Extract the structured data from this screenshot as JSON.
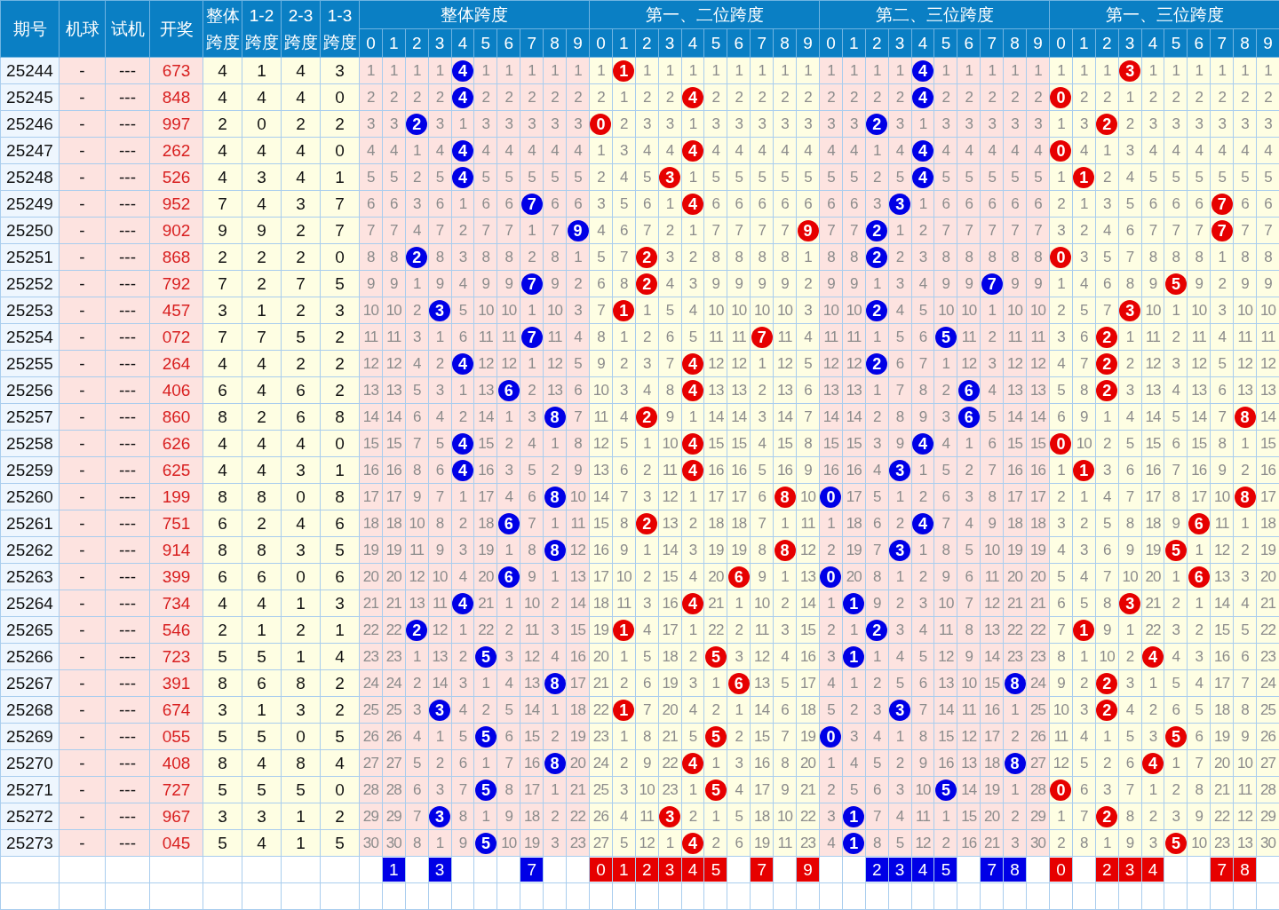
{
  "header": {
    "fixed": [
      "期号",
      "机球",
      "试机",
      "开奖"
    ],
    "spans": [
      "整体跨度",
      "1-2跨度",
      "2-3跨度",
      "1-3跨度"
    ]
  },
  "groups": [
    {
      "title": "整体跨度",
      "color": "#0000e6",
      "digits": [
        "0",
        "1",
        "2",
        "3",
        "4",
        "5",
        "6",
        "7",
        "8",
        "9"
      ]
    },
    {
      "title": "第一、二位跨度",
      "color": "#e60000",
      "digits": [
        "0",
        "1",
        "2",
        "3",
        "4",
        "5",
        "6",
        "7",
        "8",
        "9"
      ]
    },
    {
      "title": "第二、三位跨度",
      "color": "#0000e6",
      "digits": [
        "0",
        "1",
        "2",
        "3",
        "4",
        "5",
        "6",
        "7",
        "8",
        "9"
      ]
    },
    {
      "title": "第一、三位跨度",
      "color": "#e60000",
      "digits": [
        "0",
        "1",
        "2",
        "3",
        "4",
        "5",
        "6",
        "7",
        "8",
        "9"
      ]
    }
  ],
  "rows": [
    {
      "issue": "25244",
      "machine": "-",
      "test": "---",
      "draw": "673",
      "spans": [
        "4",
        "1",
        "4",
        "3"
      ],
      "groups": [
        [
          "1",
          "1",
          "1",
          "1",
          {
            "text": "4",
            "hit": true
          },
          "1",
          "1",
          "1",
          "1",
          "1"
        ],
        [
          "1",
          {
            "text": "1",
            "hit": true
          },
          "1",
          "1",
          "1",
          "1",
          "1",
          "1",
          "1",
          "1"
        ],
        [
          "1",
          "1",
          "1",
          "1",
          {
            "text": "4",
            "hit": true
          },
          "1",
          "1",
          "1",
          "1",
          "1"
        ],
        [
          "1",
          "1",
          "1",
          {
            "text": "3",
            "hit": true
          },
          "1",
          "1",
          "1",
          "1",
          "1",
          "1"
        ]
      ]
    },
    {
      "issue": "25245",
      "machine": "-",
      "test": "---",
      "draw": "848",
      "spans": [
        "4",
        "4",
        "4",
        "0"
      ],
      "groups": [
        [
          "2",
          "2",
          "2",
          "2",
          {
            "text": "4",
            "hit": true
          },
          "2",
          "2",
          "2",
          "2",
          "2"
        ],
        [
          "2",
          "1",
          "2",
          "2",
          {
            "text": "4",
            "hit": true
          },
          "2",
          "2",
          "2",
          "2",
          "2"
        ],
        [
          "2",
          "2",
          "2",
          "2",
          {
            "text": "4",
            "hit": true
          },
          "2",
          "2",
          "2",
          "2",
          "2"
        ],
        [
          {
            "text": "0",
            "hit": true
          },
          "2",
          "2",
          "1",
          "2",
          "2",
          "2",
          "2",
          "2",
          "2"
        ]
      ]
    },
    {
      "issue": "25246",
      "machine": "-",
      "test": "---",
      "draw": "997",
      "spans": [
        "2",
        "0",
        "2",
        "2"
      ],
      "groups": [
        [
          "3",
          "3",
          {
            "text": "2",
            "hit": true
          },
          "3",
          "1",
          "3",
          "3",
          "3",
          "3",
          "3"
        ],
        [
          {
            "text": "0",
            "hit": true
          },
          "2",
          "3",
          "3",
          "1",
          "3",
          "3",
          "3",
          "3",
          "3"
        ],
        [
          "3",
          "3",
          {
            "text": "2",
            "hit": true
          },
          "3",
          "1",
          "3",
          "3",
          "3",
          "3",
          "3"
        ],
        [
          "1",
          "3",
          {
            "text": "2",
            "hit": true
          },
          "2",
          "3",
          "3",
          "3",
          "3",
          "3",
          "3"
        ]
      ]
    },
    {
      "issue": "25247",
      "machine": "-",
      "test": "---",
      "draw": "262",
      "spans": [
        "4",
        "4",
        "4",
        "0"
      ],
      "groups": [
        [
          "4",
          "4",
          "1",
          "4",
          {
            "text": "4",
            "hit": true
          },
          "4",
          "4",
          "4",
          "4",
          "4"
        ],
        [
          "1",
          "3",
          "4",
          "4",
          {
            "text": "4",
            "hit": true
          },
          "4",
          "4",
          "4",
          "4",
          "4"
        ],
        [
          "4",
          "4",
          "1",
          "4",
          {
            "text": "4",
            "hit": true
          },
          "4",
          "4",
          "4",
          "4",
          "4"
        ],
        [
          {
            "text": "0",
            "hit": true
          },
          "4",
          "1",
          "3",
          "4",
          "4",
          "4",
          "4",
          "4",
          "4"
        ]
      ]
    },
    {
      "issue": "25248",
      "machine": "-",
      "test": "---",
      "draw": "526",
      "spans": [
        "4",
        "3",
        "4",
        "1"
      ],
      "groups": [
        [
          "5",
          "5",
          "2",
          "5",
          {
            "text": "4",
            "hit": true
          },
          "5",
          "5",
          "5",
          "5",
          "5"
        ],
        [
          "2",
          "4",
          "5",
          {
            "text": "3",
            "hit": true
          },
          "1",
          "5",
          "5",
          "5",
          "5",
          "5"
        ],
        [
          "5",
          "5",
          "2",
          "5",
          {
            "text": "4",
            "hit": true
          },
          "5",
          "5",
          "5",
          "5",
          "5"
        ],
        [
          "1",
          {
            "text": "1",
            "hit": true
          },
          "2",
          "4",
          "5",
          "5",
          "5",
          "5",
          "5",
          "5"
        ]
      ]
    },
    {
      "issue": "25249",
      "machine": "-",
      "test": "---",
      "draw": "952",
      "spans": [
        "7",
        "4",
        "3",
        "7"
      ],
      "groups": [
        [
          "6",
          "6",
          "3",
          "6",
          "1",
          "6",
          "6",
          {
            "text": "7",
            "hit": true
          },
          "6",
          "6"
        ],
        [
          "3",
          "5",
          "6",
          "1",
          {
            "text": "4",
            "hit": true
          },
          "6",
          "6",
          "6",
          "6",
          "6"
        ],
        [
          "6",
          "6",
          "3",
          {
            "text": "3",
            "hit": true
          },
          "1",
          "6",
          "6",
          "6",
          "6",
          "6"
        ],
        [
          "2",
          "1",
          "3",
          "5",
          "6",
          "6",
          "6",
          {
            "text": "7",
            "hit": true
          },
          "6",
          "6"
        ]
      ]
    },
    {
      "issue": "25250",
      "machine": "-",
      "test": "---",
      "draw": "902",
      "spans": [
        "9",
        "9",
        "2",
        "7"
      ],
      "groups": [
        [
          "7",
          "7",
          "4",
          "7",
          "2",
          "7",
          "7",
          "1",
          "7",
          {
            "text": "9",
            "hit": true
          }
        ],
        [
          "4",
          "6",
          "7",
          "2",
          "1",
          "7",
          "7",
          "7",
          "7",
          {
            "text": "9",
            "hit": true
          }
        ],
        [
          "7",
          "7",
          {
            "text": "2",
            "hit": true
          },
          "1",
          "2",
          "7",
          "7",
          "7",
          "7",
          "7"
        ],
        [
          "3",
          "2",
          "4",
          "6",
          "7",
          "7",
          "7",
          {
            "text": "7",
            "hit": true
          },
          "7",
          "7"
        ]
      ]
    },
    {
      "issue": "25251",
      "machine": "-",
      "test": "---",
      "draw": "868",
      "spans": [
        "2",
        "2",
        "2",
        "0"
      ],
      "groups": [
        [
          "8",
          "8",
          {
            "text": "2",
            "hit": true
          },
          "8",
          "3",
          "8",
          "8",
          "2",
          "8",
          "1"
        ],
        [
          "5",
          "7",
          {
            "text": "2",
            "hit": true
          },
          "3",
          "2",
          "8",
          "8",
          "8",
          "8",
          "1"
        ],
        [
          "8",
          "8",
          {
            "text": "2",
            "hit": true
          },
          "2",
          "3",
          "8",
          "8",
          "8",
          "8",
          "8"
        ],
        [
          {
            "text": "0",
            "hit": true
          },
          "3",
          "5",
          "7",
          "8",
          "8",
          "8",
          "1",
          "8",
          "8"
        ]
      ]
    },
    {
      "issue": "25252",
      "machine": "-",
      "test": "---",
      "draw": "792",
      "spans": [
        "7",
        "2",
        "7",
        "5"
      ],
      "groups": [
        [
          "9",
          "9",
          "1",
          "9",
          "4",
          "9",
          "9",
          {
            "text": "7",
            "hit": true
          },
          "9",
          "2"
        ],
        [
          "6",
          "8",
          {
            "text": "2",
            "hit": true
          },
          "4",
          "3",
          "9",
          "9",
          "9",
          "9",
          "2"
        ],
        [
          "9",
          "9",
          "1",
          "3",
          "4",
          "9",
          "9",
          {
            "text": "7",
            "hit": true
          },
          "9",
          "9"
        ],
        [
          "1",
          "4",
          "6",
          "8",
          "9",
          {
            "text": "5",
            "hit": true
          },
          "9",
          "2",
          "9",
          "9"
        ]
      ]
    },
    {
      "issue": "25253",
      "machine": "-",
      "test": "---",
      "draw": "457",
      "spans": [
        "3",
        "1",
        "2",
        "3"
      ],
      "groups": [
        [
          "10",
          "10",
          "2",
          {
            "text": "3",
            "hit": true
          },
          "5",
          "10",
          "10",
          "1",
          "10",
          "3"
        ],
        [
          "7",
          {
            "text": "1",
            "hit": true
          },
          "1",
          "5",
          "4",
          "10",
          "10",
          "10",
          "10",
          "3"
        ],
        [
          "10",
          "10",
          {
            "text": "2",
            "hit": true
          },
          "4",
          "5",
          "10",
          "10",
          "1",
          "10",
          "10"
        ],
        [
          "2",
          "5",
          "7",
          {
            "text": "3",
            "hit": true
          },
          "10",
          "1",
          "10",
          "3",
          "10",
          "10"
        ]
      ]
    },
    {
      "issue": "25254",
      "machine": "-",
      "test": "---",
      "draw": "072",
      "spans": [
        "7",
        "7",
        "5",
        "2"
      ],
      "groups": [
        [
          "11",
          "11",
          "3",
          "1",
          "6",
          "11",
          "11",
          {
            "text": "7",
            "hit": true
          },
          "11",
          "4"
        ],
        [
          "8",
          "1",
          "2",
          "6",
          "5",
          "11",
          "11",
          {
            "text": "7",
            "hit": true
          },
          "11",
          "4"
        ],
        [
          "11",
          "11",
          "1",
          "5",
          "6",
          {
            "text": "5",
            "hit": true
          },
          "11",
          "2",
          "11",
          "11"
        ],
        [
          "3",
          "6",
          {
            "text": "2",
            "hit": true
          },
          "1",
          "11",
          "2",
          "11",
          "4",
          "11",
          "11"
        ]
      ]
    },
    {
      "issue": "25255",
      "machine": "-",
      "test": "---",
      "draw": "264",
      "spans": [
        "4",
        "4",
        "2",
        "2"
      ],
      "groups": [
        [
          "12",
          "12",
          "4",
          "2",
          {
            "text": "4",
            "hit": true
          },
          "12",
          "12",
          "1",
          "12",
          "5"
        ],
        [
          "9",
          "2",
          "3",
          "7",
          {
            "text": "4",
            "hit": true
          },
          "12",
          "12",
          "1",
          "12",
          "5"
        ],
        [
          "12",
          "12",
          {
            "text": "2",
            "hit": true
          },
          "6",
          "7",
          "1",
          "12",
          "3",
          "12",
          "12"
        ],
        [
          "4",
          "7",
          {
            "text": "2",
            "hit": true
          },
          "2",
          "12",
          "3",
          "12",
          "5",
          "12",
          "12"
        ]
      ]
    },
    {
      "issue": "25256",
      "machine": "-",
      "test": "---",
      "draw": "406",
      "spans": [
        "6",
        "4",
        "6",
        "2"
      ],
      "groups": [
        [
          "13",
          "13",
          "5",
          "3",
          "1",
          "13",
          {
            "text": "6",
            "hit": true
          },
          "2",
          "13",
          "6"
        ],
        [
          "10",
          "3",
          "4",
          "8",
          {
            "text": "4",
            "hit": true
          },
          "13",
          "13",
          "2",
          "13",
          "6"
        ],
        [
          "13",
          "13",
          "1",
          "7",
          "8",
          "2",
          {
            "text": "6",
            "hit": true
          },
          "4",
          "13",
          "13"
        ],
        [
          "5",
          "8",
          {
            "text": "2",
            "hit": true
          },
          "3",
          "13",
          "4",
          "13",
          "6",
          "13",
          "13"
        ]
      ]
    },
    {
      "issue": "25257",
      "machine": "-",
      "test": "---",
      "draw": "860",
      "spans": [
        "8",
        "2",
        "6",
        "8"
      ],
      "groups": [
        [
          "14",
          "14",
          "6",
          "4",
          "2",
          "14",
          "1",
          "3",
          {
            "text": "8",
            "hit": true
          },
          "7"
        ],
        [
          "11",
          "4",
          {
            "text": "2",
            "hit": true
          },
          "9",
          "1",
          "14",
          "14",
          "3",
          "14",
          "7"
        ],
        [
          "14",
          "14",
          "2",
          "8",
          "9",
          "3",
          {
            "text": "6",
            "hit": true
          },
          "5",
          "14",
          "14"
        ],
        [
          "6",
          "9",
          "1",
          "4",
          "14",
          "5",
          "14",
          "7",
          {
            "text": "8",
            "hit": true
          },
          "14"
        ]
      ]
    },
    {
      "issue": "25258",
      "machine": "-",
      "test": "---",
      "draw": "626",
      "spans": [
        "4",
        "4",
        "4",
        "0"
      ],
      "groups": [
        [
          "15",
          "15",
          "7",
          "5",
          {
            "text": "4",
            "hit": true
          },
          "15",
          "2",
          "4",
          "1",
          "8"
        ],
        [
          "12",
          "5",
          "1",
          "10",
          {
            "text": "4",
            "hit": true
          },
          "15",
          "15",
          "4",
          "15",
          "8"
        ],
        [
          "15",
          "15",
          "3",
          "9",
          {
            "text": "4",
            "hit": true
          },
          "4",
          "1",
          "6",
          "15",
          "15"
        ],
        [
          {
            "text": "0",
            "hit": true
          },
          "10",
          "2",
          "5",
          "15",
          "6",
          "15",
          "8",
          "1",
          "15"
        ]
      ]
    },
    {
      "issue": "25259",
      "machine": "-",
      "test": "---",
      "draw": "625",
      "spans": [
        "4",
        "4",
        "3",
        "1"
      ],
      "groups": [
        [
          "16",
          "16",
          "8",
          "6",
          {
            "text": "4",
            "hit": true
          },
          "16",
          "3",
          "5",
          "2",
          "9"
        ],
        [
          "13",
          "6",
          "2",
          "11",
          {
            "text": "4",
            "hit": true
          },
          "16",
          "16",
          "5",
          "16",
          "9"
        ],
        [
          "16",
          "16",
          "4",
          {
            "text": "3",
            "hit": true
          },
          "1",
          "5",
          "2",
          "7",
          "16",
          "16"
        ],
        [
          "1",
          {
            "text": "1",
            "hit": true
          },
          "3",
          "6",
          "16",
          "7",
          "16",
          "9",
          "2",
          "16"
        ]
      ]
    },
    {
      "issue": "25260",
      "machine": "-",
      "test": "---",
      "draw": "199",
      "spans": [
        "8",
        "8",
        "0",
        "8"
      ],
      "groups": [
        [
          "17",
          "17",
          "9",
          "7",
          "1",
          "17",
          "4",
          "6",
          {
            "text": "8",
            "hit": true
          },
          "10"
        ],
        [
          "14",
          "7",
          "3",
          "12",
          "1",
          "17",
          "17",
          "6",
          {
            "text": "8",
            "hit": true
          },
          "10"
        ],
        [
          {
            "text": "0",
            "hit": true
          },
          "17",
          "5",
          "1",
          "2",
          "6",
          "3",
          "8",
          "17",
          "17"
        ],
        [
          "2",
          "1",
          "4",
          "7",
          "17",
          "8",
          "17",
          "10",
          {
            "text": "8",
            "hit": true
          },
          "17"
        ]
      ]
    },
    {
      "issue": "25261",
      "machine": "-",
      "test": "---",
      "draw": "751",
      "spans": [
        "6",
        "2",
        "4",
        "6"
      ],
      "groups": [
        [
          "18",
          "18",
          "10",
          "8",
          "2",
          "18",
          {
            "text": "6",
            "hit": true
          },
          "7",
          "1",
          "11"
        ],
        [
          "15",
          "8",
          {
            "text": "2",
            "hit": true
          },
          "13",
          "2",
          "18",
          "18",
          "7",
          "1",
          "11"
        ],
        [
          "1",
          "18",
          "6",
          "2",
          {
            "text": "4",
            "hit": true
          },
          "7",
          "4",
          "9",
          "18",
          "18"
        ],
        [
          "3",
          "2",
          "5",
          "8",
          "18",
          "9",
          {
            "text": "6",
            "hit": true
          },
          "11",
          "1",
          "18"
        ]
      ]
    },
    {
      "issue": "25262",
      "machine": "-",
      "test": "---",
      "draw": "914",
      "spans": [
        "8",
        "8",
        "3",
        "5"
      ],
      "groups": [
        [
          "19",
          "19",
          "11",
          "9",
          "3",
          "19",
          "1",
          "8",
          {
            "text": "8",
            "hit": true
          },
          "12"
        ],
        [
          "16",
          "9",
          "1",
          "14",
          "3",
          "19",
          "19",
          "8",
          {
            "text": "8",
            "hit": true
          },
          "12"
        ],
        [
          "2",
          "19",
          "7",
          {
            "text": "3",
            "hit": true
          },
          "1",
          "8",
          "5",
          "10",
          "19",
          "19"
        ],
        [
          "4",
          "3",
          "6",
          "9",
          "19",
          {
            "text": "5",
            "hit": true
          },
          "1",
          "12",
          "2",
          "19"
        ]
      ]
    },
    {
      "issue": "25263",
      "machine": "-",
      "test": "---",
      "draw": "399",
      "spans": [
        "6",
        "6",
        "0",
        "6"
      ],
      "groups": [
        [
          "20",
          "20",
          "12",
          "10",
          "4",
          "20",
          {
            "text": "6",
            "hit": true
          },
          "9",
          "1",
          "13"
        ],
        [
          "17",
          "10",
          "2",
          "15",
          "4",
          "20",
          {
            "text": "6",
            "hit": true
          },
          "9",
          "1",
          "13"
        ],
        [
          {
            "text": "0",
            "hit": true
          },
          "20",
          "8",
          "1",
          "2",
          "9",
          "6",
          "11",
          "20",
          "20"
        ],
        [
          "5",
          "4",
          "7",
          "10",
          "20",
          "1",
          {
            "text": "6",
            "hit": true
          },
          "13",
          "3",
          "20"
        ]
      ]
    },
    {
      "issue": "25264",
      "machine": "-",
      "test": "---",
      "draw": "734",
      "spans": [
        "4",
        "4",
        "1",
        "3"
      ],
      "groups": [
        [
          "21",
          "21",
          "13",
          "11",
          {
            "text": "4",
            "hit": true
          },
          "21",
          "1",
          "10",
          "2",
          "14"
        ],
        [
          "18",
          "11",
          "3",
          "16",
          {
            "text": "4",
            "hit": true
          },
          "21",
          "1",
          "10",
          "2",
          "14"
        ],
        [
          "1",
          {
            "text": "1",
            "hit": true
          },
          "9",
          "2",
          "3",
          "10",
          "7",
          "12",
          "21",
          "21"
        ],
        [
          "6",
          "5",
          "8",
          {
            "text": "3",
            "hit": true
          },
          "21",
          "2",
          "1",
          "14",
          "4",
          "21"
        ]
      ]
    },
    {
      "issue": "25265",
      "machine": "-",
      "test": "---",
      "draw": "546",
      "spans": [
        "2",
        "1",
        "2",
        "1"
      ],
      "groups": [
        [
          "22",
          "22",
          {
            "text": "2",
            "hit": true
          },
          "12",
          "1",
          "22",
          "2",
          "11",
          "3",
          "15"
        ],
        [
          "19",
          {
            "text": "1",
            "hit": true
          },
          "4",
          "17",
          "1",
          "22",
          "2",
          "11",
          "3",
          "15"
        ],
        [
          "2",
          "1",
          {
            "text": "2",
            "hit": true
          },
          "3",
          "4",
          "11",
          "8",
          "13",
          "22",
          "22"
        ],
        [
          "7",
          {
            "text": "1",
            "hit": true
          },
          "9",
          "1",
          "22",
          "3",
          "2",
          "15",
          "5",
          "22"
        ]
      ]
    },
    {
      "issue": "25266",
      "machine": "-",
      "test": "---",
      "draw": "723",
      "spans": [
        "5",
        "5",
        "1",
        "4"
      ],
      "groups": [
        [
          "23",
          "23",
          "1",
          "13",
          "2",
          {
            "text": "5",
            "hit": true
          },
          "3",
          "12",
          "4",
          "16"
        ],
        [
          "20",
          "1",
          "5",
          "18",
          "2",
          {
            "text": "5",
            "hit": true
          },
          "3",
          "12",
          "4",
          "16"
        ],
        [
          "3",
          {
            "text": "1",
            "hit": true
          },
          "1",
          "4",
          "5",
          "12",
          "9",
          "14",
          "23",
          "23"
        ],
        [
          "8",
          "1",
          "10",
          "2",
          {
            "text": "4",
            "hit": true
          },
          "4",
          "3",
          "16",
          "6",
          "23"
        ]
      ]
    },
    {
      "issue": "25267",
      "machine": "-",
      "test": "---",
      "draw": "391",
      "spans": [
        "8",
        "6",
        "8",
        "2"
      ],
      "groups": [
        [
          "24",
          "24",
          "2",
          "14",
          "3",
          "1",
          "4",
          "13",
          {
            "text": "8",
            "hit": true
          },
          "17"
        ],
        [
          "21",
          "2",
          "6",
          "19",
          "3",
          "1",
          {
            "text": "6",
            "hit": true
          },
          "13",
          "5",
          "17"
        ],
        [
          "4",
          "1",
          "2",
          "5",
          "6",
          "13",
          "10",
          "15",
          {
            "text": "8",
            "hit": true
          },
          "24"
        ],
        [
          "9",
          "2",
          {
            "text": "2",
            "hit": true
          },
          "3",
          "1",
          "5",
          "4",
          "17",
          "7",
          "24"
        ]
      ]
    },
    {
      "issue": "25268",
      "machine": "-",
      "test": "---",
      "draw": "674",
      "spans": [
        "3",
        "1",
        "3",
        "2"
      ],
      "groups": [
        [
          "25",
          "25",
          "3",
          {
            "text": "3",
            "hit": true
          },
          "4",
          "2",
          "5",
          "14",
          "1",
          "18"
        ],
        [
          "22",
          {
            "text": "1",
            "hit": true
          },
          "7",
          "20",
          "4",
          "2",
          "1",
          "14",
          "6",
          "18"
        ],
        [
          "5",
          "2",
          "3",
          {
            "text": "3",
            "hit": true
          },
          "7",
          "14",
          "11",
          "16",
          "1",
          "25"
        ],
        [
          "10",
          "3",
          {
            "text": "2",
            "hit": true
          },
          "4",
          "2",
          "6",
          "5",
          "18",
          "8",
          "25"
        ]
      ]
    },
    {
      "issue": "25269",
      "machine": "-",
      "test": "---",
      "draw": "055",
      "spans": [
        "5",
        "5",
        "0",
        "5"
      ],
      "groups": [
        [
          "26",
          "26",
          "4",
          "1",
          "5",
          {
            "text": "5",
            "hit": true
          },
          "6",
          "15",
          "2",
          "19"
        ],
        [
          "23",
          "1",
          "8",
          "21",
          "5",
          {
            "text": "5",
            "hit": true
          },
          "2",
          "15",
          "7",
          "19"
        ],
        [
          {
            "text": "0",
            "hit": true
          },
          "3",
          "4",
          "1",
          "8",
          "15",
          "12",
          "17",
          "2",
          "26"
        ],
        [
          "11",
          "4",
          "1",
          "5",
          "3",
          {
            "text": "5",
            "hit": true
          },
          "6",
          "19",
          "9",
          "26"
        ]
      ]
    },
    {
      "issue": "25270",
      "machine": "-",
      "test": "---",
      "draw": "408",
      "spans": [
        "8",
        "4",
        "8",
        "4"
      ],
      "groups": [
        [
          "27",
          "27",
          "5",
          "2",
          "6",
          "1",
          "7",
          "16",
          {
            "text": "8",
            "hit": true
          },
          "20"
        ],
        [
          "24",
          "2",
          "9",
          "22",
          {
            "text": "4",
            "hit": true
          },
          "1",
          "3",
          "16",
          "8",
          "20"
        ],
        [
          "1",
          "4",
          "5",
          "2",
          "9",
          "16",
          "13",
          "18",
          {
            "text": "8",
            "hit": true
          },
          "27"
        ],
        [
          "12",
          "5",
          "2",
          "6",
          {
            "text": "4",
            "hit": true
          },
          "1",
          "7",
          "20",
          "10",
          "27"
        ]
      ]
    },
    {
      "issue": "25271",
      "machine": "-",
      "test": "---",
      "draw": "727",
      "spans": [
        "5",
        "5",
        "5",
        "0"
      ],
      "groups": [
        [
          "28",
          "28",
          "6",
          "3",
          "7",
          {
            "text": "5",
            "hit": true
          },
          "8",
          "17",
          "1",
          "21"
        ],
        [
          "25",
          "3",
          "10",
          "23",
          "1",
          {
            "text": "5",
            "hit": true
          },
          "4",
          "17",
          "9",
          "21"
        ],
        [
          "2",
          "5",
          "6",
          "3",
          "10",
          {
            "text": "5",
            "hit": true
          },
          "14",
          "19",
          "1",
          "28"
        ],
        [
          {
            "text": "0",
            "hit": true
          },
          "6",
          "3",
          "7",
          "1",
          "2",
          "8",
          "21",
          "11",
          "28"
        ]
      ]
    },
    {
      "issue": "25272",
      "machine": "-",
      "test": "---",
      "draw": "967",
      "spans": [
        "3",
        "3",
        "1",
        "2"
      ],
      "groups": [
        [
          "29",
          "29",
          "7",
          {
            "text": "3",
            "hit": true
          },
          "8",
          "1",
          "9",
          "18",
          "2",
          "22"
        ],
        [
          "26",
          "4",
          "11",
          {
            "text": "3",
            "hit": true
          },
          "2",
          "1",
          "5",
          "18",
          "10",
          "22"
        ],
        [
          "3",
          {
            "text": "1",
            "hit": true
          },
          "7",
          "4",
          "11",
          "1",
          "15",
          "20",
          "2",
          "29"
        ],
        [
          "1",
          "7",
          {
            "text": "2",
            "hit": true
          },
          "8",
          "2",
          "3",
          "9",
          "22",
          "12",
          "29"
        ]
      ]
    },
    {
      "issue": "25273",
      "machine": "-",
      "test": "---",
      "draw": "045",
      "spans": [
        "5",
        "4",
        "1",
        "5"
      ],
      "groups": [
        [
          "30",
          "30",
          "8",
          "1",
          "9",
          {
            "text": "5",
            "hit": true
          },
          "10",
          "19",
          "3",
          "23"
        ],
        [
          "27",
          "5",
          "12",
          "1",
          {
            "text": "4",
            "hit": true
          },
          "2",
          "6",
          "19",
          "11",
          "23"
        ],
        [
          "4",
          {
            "text": "1",
            "hit": true
          },
          "8",
          "5",
          "12",
          "2",
          "16",
          "21",
          "3",
          "30"
        ],
        [
          "2",
          "8",
          "1",
          "9",
          "3",
          {
            "text": "5",
            "hit": true
          },
          "10",
          "23",
          "13",
          "30"
        ]
      ]
    }
  ],
  "footer": [
    [
      {
        "marked": false
      },
      {
        "marked": true,
        "text": "1"
      },
      {
        "marked": false
      },
      {
        "marked": true,
        "text": "3"
      },
      {
        "marked": false
      },
      {
        "marked": false
      },
      {
        "marked": false
      },
      {
        "marked": true,
        "text": "7"
      },
      {
        "marked": false
      },
      {
        "marked": false
      }
    ],
    [
      {
        "marked": true,
        "text": "0"
      },
      {
        "marked": true,
        "text": "1"
      },
      {
        "marked": true,
        "text": "2"
      },
      {
        "marked": true,
        "text": "3"
      },
      {
        "marked": true,
        "text": "4"
      },
      {
        "marked": true,
        "text": "5"
      },
      {
        "marked": false
      },
      {
        "marked": true,
        "text": "7"
      },
      {
        "marked": false
      },
      {
        "marked": true,
        "text": "9"
      }
    ],
    [
      {
        "marked": false
      },
      {
        "marked": false
      },
      {
        "marked": true,
        "text": "2"
      },
      {
        "marked": true,
        "text": "3"
      },
      {
        "marked": true,
        "text": "4"
      },
      {
        "marked": true,
        "text": "5"
      },
      {
        "marked": false
      },
      {
        "marked": true,
        "text": "7"
      },
      {
        "marked": true,
        "text": "8"
      },
      {
        "marked": false
      }
    ],
    [
      {
        "marked": true,
        "text": "0"
      },
      {
        "marked": false
      },
      {
        "marked": true,
        "text": "2"
      },
      {
        "marked": true,
        "text": "3"
      },
      {
        "marked": true,
        "text": "4"
      },
      {
        "marked": false
      },
      {
        "marked": false
      },
      {
        "marked": true,
        "text": "7"
      },
      {
        "marked": true,
        "text": "8"
      },
      {
        "marked": false
      }
    ]
  ]
}
